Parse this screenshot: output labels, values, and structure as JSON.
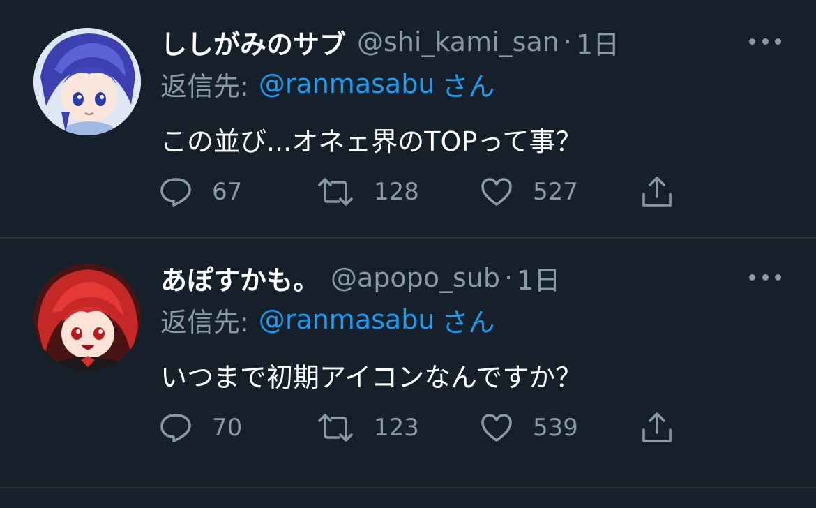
{
  "colors": {
    "background": "#15202b",
    "divider": "#2f3336",
    "primary_text": "#ffffff",
    "secondary_text": "#8b98a5",
    "accent": "#1d9bf0"
  },
  "tweets": [
    {
      "display_name": "ししがみのサブ",
      "handle": "@shi_kami_san",
      "separator": "·",
      "time": "1日",
      "reply_prefix": "返信先:",
      "reply_target": "@ranmasabu",
      "reply_suffix": "さん",
      "text": "この並び...オネェ界のTOPって事？",
      "avatar": "blue-haired-anime-avatar",
      "more_icon": "more-dots-icon",
      "actions": {
        "reply": {
          "icon": "reply-icon",
          "count": "67"
        },
        "retweet": {
          "icon": "retweet-icon",
          "count": "128"
        },
        "like": {
          "icon": "heart-icon",
          "count": "527"
        },
        "share": {
          "icon": "share-icon"
        }
      }
    },
    {
      "display_name": "あぽすかも。",
      "handle": "@apopo_sub",
      "separator": "·",
      "time": "1日",
      "reply_prefix": "返信先:",
      "reply_target": "@ranmasabu",
      "reply_suffix": "さん",
      "text": "いつまで初期アイコンなんですか？",
      "avatar": "red-haired-anime-avatar",
      "more_icon": "more-dots-icon",
      "actions": {
        "reply": {
          "icon": "reply-icon",
          "count": "70"
        },
        "retweet": {
          "icon": "retweet-icon",
          "count": "123"
        },
        "like": {
          "icon": "heart-icon",
          "count": "539"
        },
        "share": {
          "icon": "share-icon"
        }
      }
    }
  ]
}
